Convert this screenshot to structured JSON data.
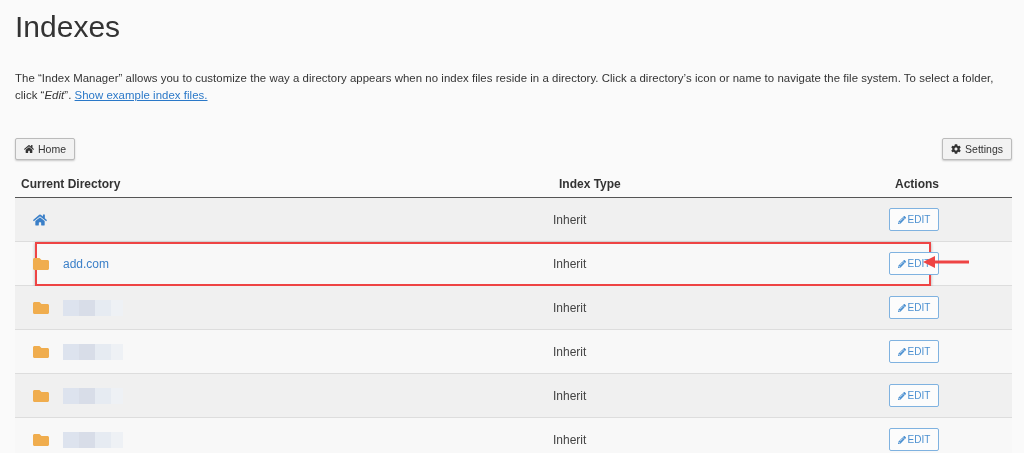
{
  "title": "Indexes",
  "description": "The “Index Manager” allows you to customize the way a directory appears when no index files reside in a directory. Click a directory’s icon or name to navigate the file system. To select a folder, click “*Edit*”.",
  "description_link": "Show example index files.",
  "toolbar": {
    "home_button": "Home",
    "settings_button": "Settings"
  },
  "table": {
    "columns": [
      "Current Directory",
      "Index Type",
      "Actions"
    ],
    "rows": [
      {
        "kind": "home",
        "index_type": "Inherit",
        "action": "EDIT",
        "highlighted": false,
        "redacted": false
      },
      {
        "kind": "folder",
        "name": "add.com",
        "index_type": "Inherit",
        "action": "EDIT",
        "highlighted": true,
        "redacted": false
      },
      {
        "kind": "folder",
        "index_type": "Inherit",
        "action": "EDIT",
        "highlighted": false,
        "redacted": true
      },
      {
        "kind": "folder",
        "index_type": "Inherit",
        "action": "EDIT",
        "highlighted": false,
        "redacted": true
      },
      {
        "kind": "folder",
        "index_type": "Inherit",
        "action": "EDIT",
        "highlighted": false,
        "redacted": true
      },
      {
        "kind": "folder",
        "index_type": "Inherit",
        "action": "EDIT",
        "highlighted": false,
        "redacted": true
      }
    ]
  }
}
